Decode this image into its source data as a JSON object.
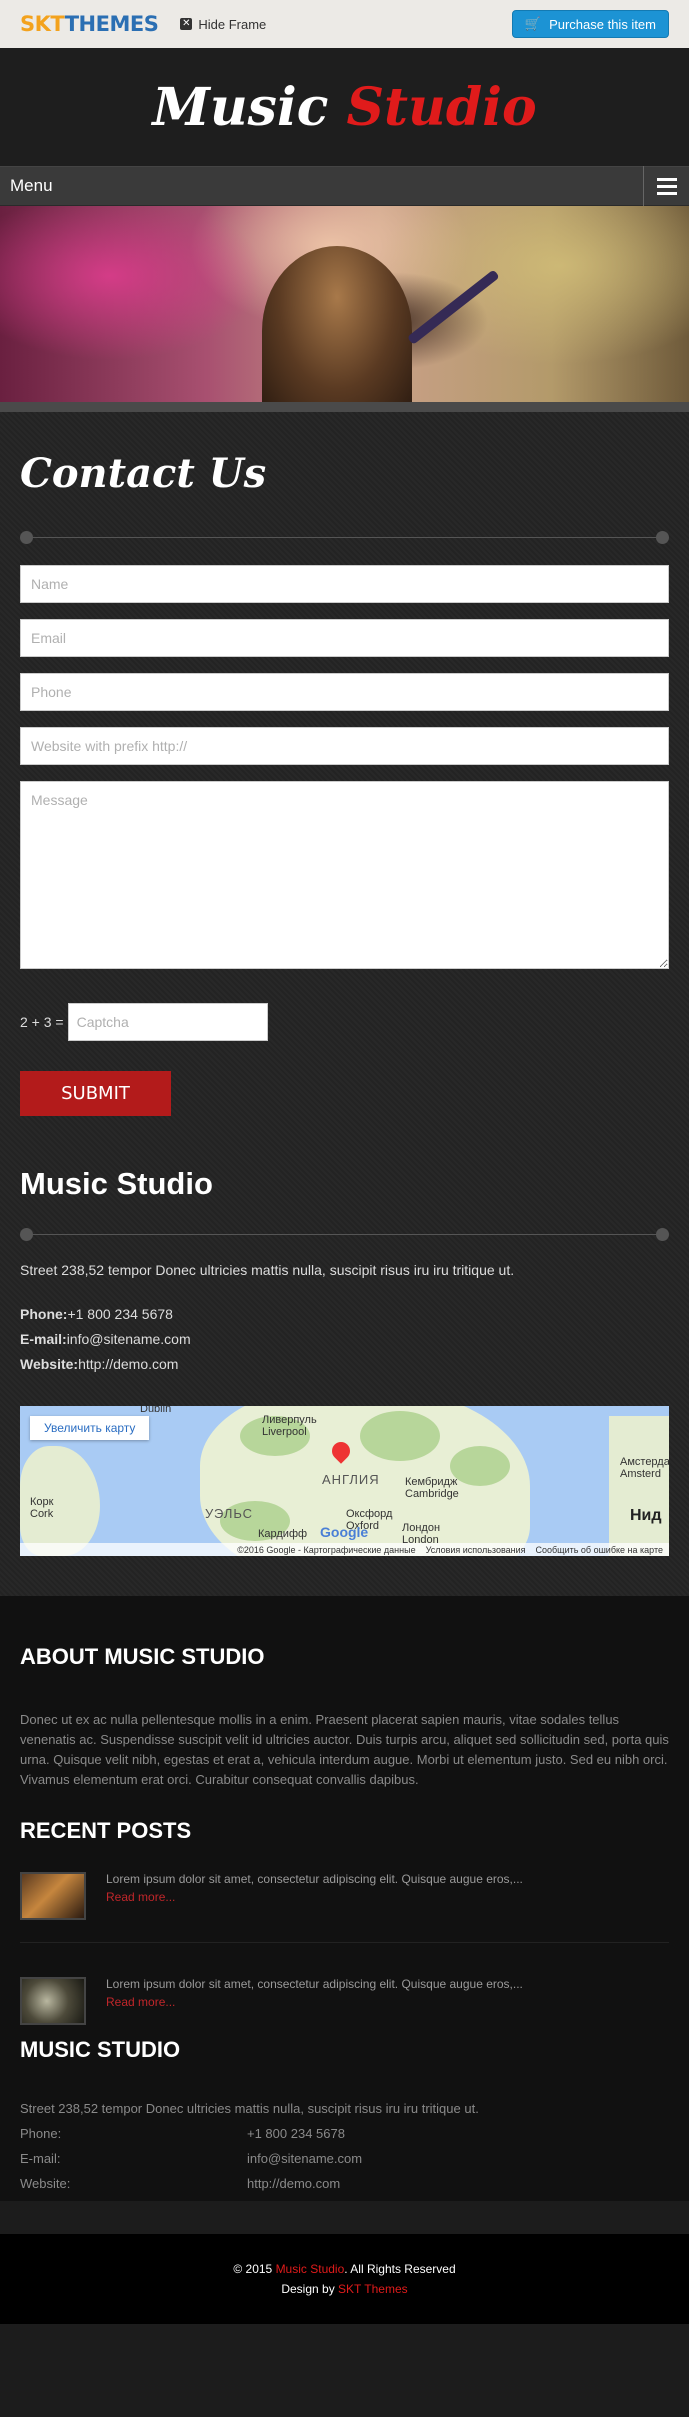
{
  "topbar": {
    "logo_part1": "SKT",
    "logo_part2": "THEMES",
    "hide_frame": "Hide Frame",
    "purchase": "Purchase this item"
  },
  "header": {
    "logo_word1": "Music",
    "logo_word2": "Studio"
  },
  "menu": {
    "label": "Menu"
  },
  "contact": {
    "title": "Contact Us",
    "name_placeholder": "Name",
    "email_placeholder": "Email",
    "phone_placeholder": "Phone",
    "website_placeholder": "Website with prefix http://",
    "message_placeholder": "Message",
    "captcha_question": "2 + 3 =",
    "captcha_placeholder": "Captcha",
    "submit": "SUBMIT"
  },
  "info": {
    "title": "Music Studio",
    "address": "Street 238,52 tempor Donec ultricies mattis nulla, suscipit risus iru iru tritique ut.",
    "phone_label": "Phone:",
    "phone": "+1 800 234 5678",
    "email_label": "E-mail:",
    "email": "info@sitename.com",
    "website_label": "Website:",
    "website": "http://demo.com"
  },
  "map": {
    "enlarge": "Увеличить карту",
    "labels": {
      "liverpool": "Ливерпуль\nLiverpool",
      "england": "АНГЛИЯ",
      "cambridge": "Кембридж\nCambridge",
      "amsterdam": "Амстердам\nAmsterd",
      "cork": "Корк\nCork",
      "wales": "УЭЛЬС",
      "oxford": "Оксфорд\nOxford",
      "cardiff": "Кардифф",
      "london": "Лондон\nLondon",
      "dublin": "Dublin",
      "nid": "Нид"
    },
    "google": "Google",
    "attribution": "©2016 Google - Картографические данные",
    "terms": "Условия использования",
    "report": "Сообщить об ошибке на карте"
  },
  "about": {
    "title": "ABOUT MUSIC STUDIO",
    "text": "Donec ut ex ac nulla pellentesque mollis in a enim. Praesent placerat sapien mauris, vitae sodales tellus venenatis ac. Suspendisse suscipit velit id ultricies auctor. Duis turpis arcu, aliquet sed sollicitudin sed, porta quis urna. Quisque velit nibh, egestas et erat a, vehicula interdum augue. Morbi ut elementum justo. Sed eu nibh orci. Vivamus elementum erat orci. Curabitur consequat convallis dapibus."
  },
  "recent": {
    "title": "RECENT POSTS",
    "posts": [
      {
        "excerpt": "Lorem ipsum dolor sit amet, consectetur adipiscing elit. Quisque augue eros,...",
        "more": "Read more..."
      },
      {
        "excerpt": "Lorem ipsum dolor sit amet, consectetur adipiscing elit. Quisque augue eros,...",
        "more": "Read more..."
      }
    ]
  },
  "studio": {
    "title": "MUSIC STUDIO",
    "address": "Street 238,52 tempor Donec ultricies mattis nulla, suscipit risus iru iru tritique ut.",
    "phone_label": "Phone:",
    "phone": "+1 800 234 5678",
    "email_label": "E-mail:",
    "email": "info@sitename.com",
    "website_label": "Website:",
    "website": "http://demo.com"
  },
  "copyright": {
    "prefix": "© 2015 ",
    "site": "Music Studio",
    "suffix": ". All Rights Reserved",
    "design_by": "Design by ",
    "designer": "SKT Themes"
  },
  "colors": {
    "accent_red": "#e01b1b",
    "button_red": "#b31b1b",
    "purchase_blue": "#1c93d4",
    "skt_orange": "#f3a21d",
    "skt_blue": "#2b6fb3"
  },
  "icons": [
    "close-icon",
    "cart-icon",
    "hamburger-icon",
    "map-pin-icon"
  ]
}
